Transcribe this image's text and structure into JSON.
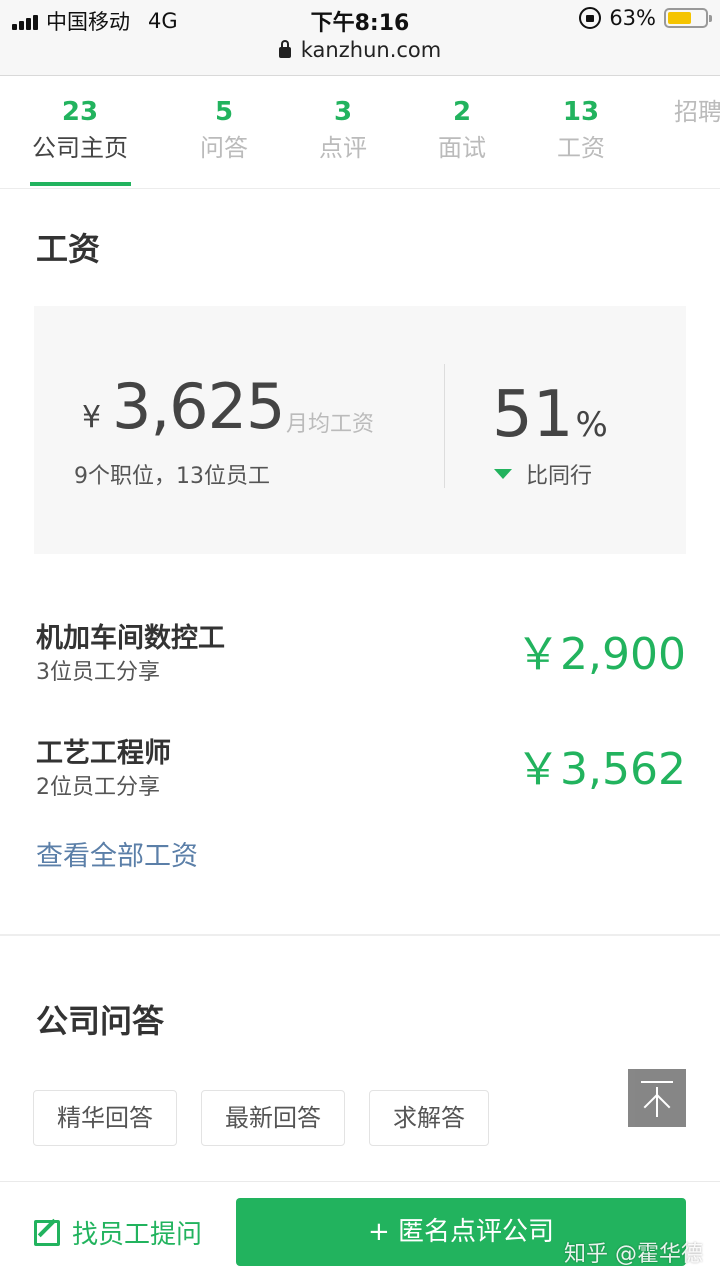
{
  "status_bar": {
    "carrier": "中国移动",
    "network": "4G",
    "time": "下午8:16",
    "battery": "63%",
    "battery_level": 0.63,
    "url": "kanzhun.com"
  },
  "tabs": [
    {
      "count": "23",
      "label": "公司主页",
      "active": true
    },
    {
      "count": "5",
      "label": "问答"
    },
    {
      "count": "3",
      "label": "点评"
    },
    {
      "count": "2",
      "label": "面试"
    },
    {
      "count": "13",
      "label": "工资"
    },
    {
      "count": "",
      "label": "招聘"
    }
  ],
  "salary": {
    "title": "工资",
    "summary": {
      "currency": "¥",
      "amount": "3,625",
      "unit": "月均工资",
      "sub": "9个职位，13位员工",
      "percent": "51",
      "percent_sign": "%",
      "compare": "比同行"
    },
    "jobs": [
      {
        "title": "机加车间数控工",
        "sub": "3位员工分享",
        "salary": "￥2,900"
      },
      {
        "title": "工艺工程师",
        "sub": "2位员工分享",
        "salary": "￥3,562"
      }
    ],
    "view_all": "查看全部工资"
  },
  "qa": {
    "title": "公司问答",
    "filters": [
      "精华回答",
      "最新回答",
      "求解答"
    ]
  },
  "bottom": {
    "ask_label": "找员工提问",
    "review_label": "+ 匿名点评公司"
  },
  "watermark": "知乎 @霍华德",
  "colors": {
    "accent": "#22b35e",
    "link": "#5b7fa8"
  }
}
